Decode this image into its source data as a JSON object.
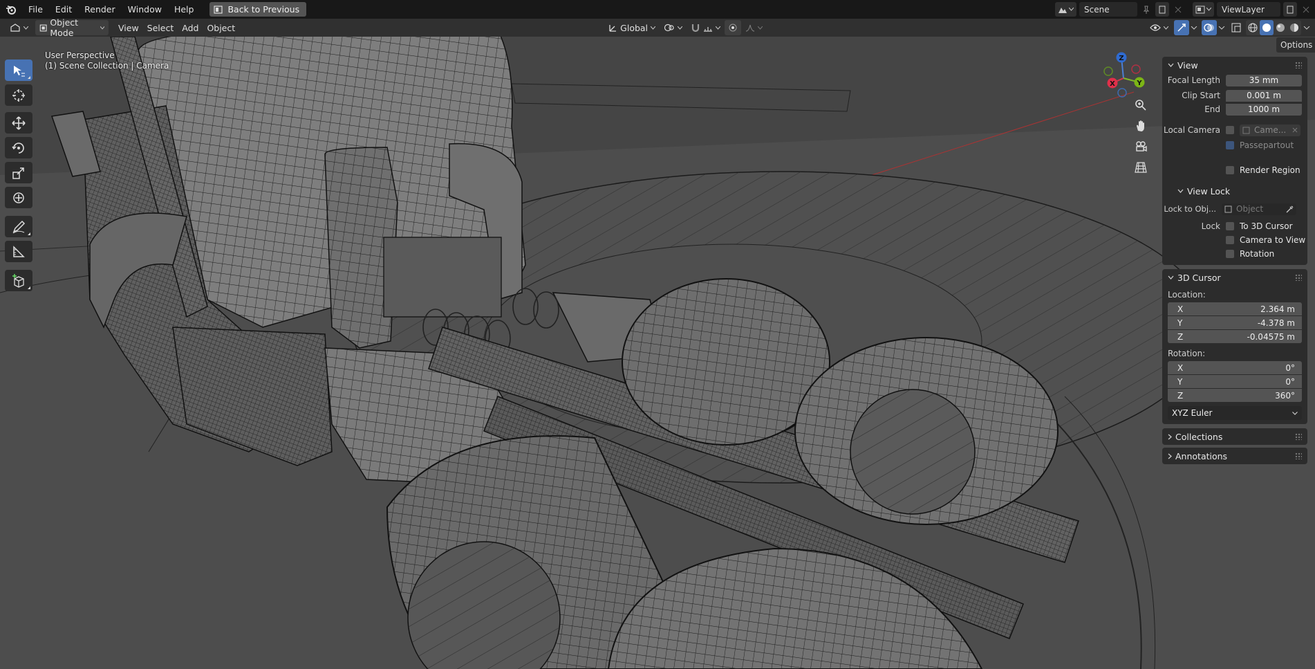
{
  "topbar": {
    "menus": [
      "File",
      "Edit",
      "Render",
      "Window",
      "Help"
    ],
    "back_button": "Back to Previous",
    "scene_name": "Scene",
    "view_layer": "ViewLayer"
  },
  "header": {
    "mode": "Object Mode",
    "menus": [
      "View",
      "Select",
      "Add",
      "Object"
    ],
    "orientation": "Global"
  },
  "viewport": {
    "perspective": "User Perspective",
    "collection": "(1) Scene Collection | Camera",
    "options": "Options"
  },
  "gizmo": {
    "z": "Z",
    "y": "Y",
    "x": "X"
  },
  "npanel": {
    "view": {
      "title": "View",
      "focal_length_label": "Focal Length",
      "focal_length": "35 mm",
      "clip_start_label": "Clip Start",
      "clip_start": "0.001 m",
      "end_label": "End",
      "end": "1000 m",
      "local_camera_label": "Local Camera",
      "local_camera_value": "Came...",
      "passepartout": "Passepartout",
      "render_region": "Render Region"
    },
    "view_lock": {
      "title": "View Lock",
      "lock_to_obj_label": "Lock to Obj...",
      "lock_to_obj_placeholder": "Object",
      "lock_label": "Lock",
      "to_3d_cursor": "To 3D Cursor",
      "camera_to_view": "Camera to View",
      "rotation": "Rotation"
    },
    "cursor": {
      "title": "3D Cursor",
      "location_label": "Location:",
      "loc_x": "2.364 m",
      "loc_y": "-4.378 m",
      "loc_z": "-0.04575 m",
      "rotation_label": "Rotation:",
      "rot_x": "0°",
      "rot_y": "0°",
      "rot_z": "360°",
      "rotation_mode": "XYZ Euler",
      "axis_x": "X",
      "axis_y": "Y",
      "axis_z": "Z"
    },
    "collections": "Collections",
    "annotations": "Annotations"
  },
  "colors": {
    "accent": "#4772b3",
    "viewport": "#474747",
    "panel": "#2c2c2c"
  }
}
